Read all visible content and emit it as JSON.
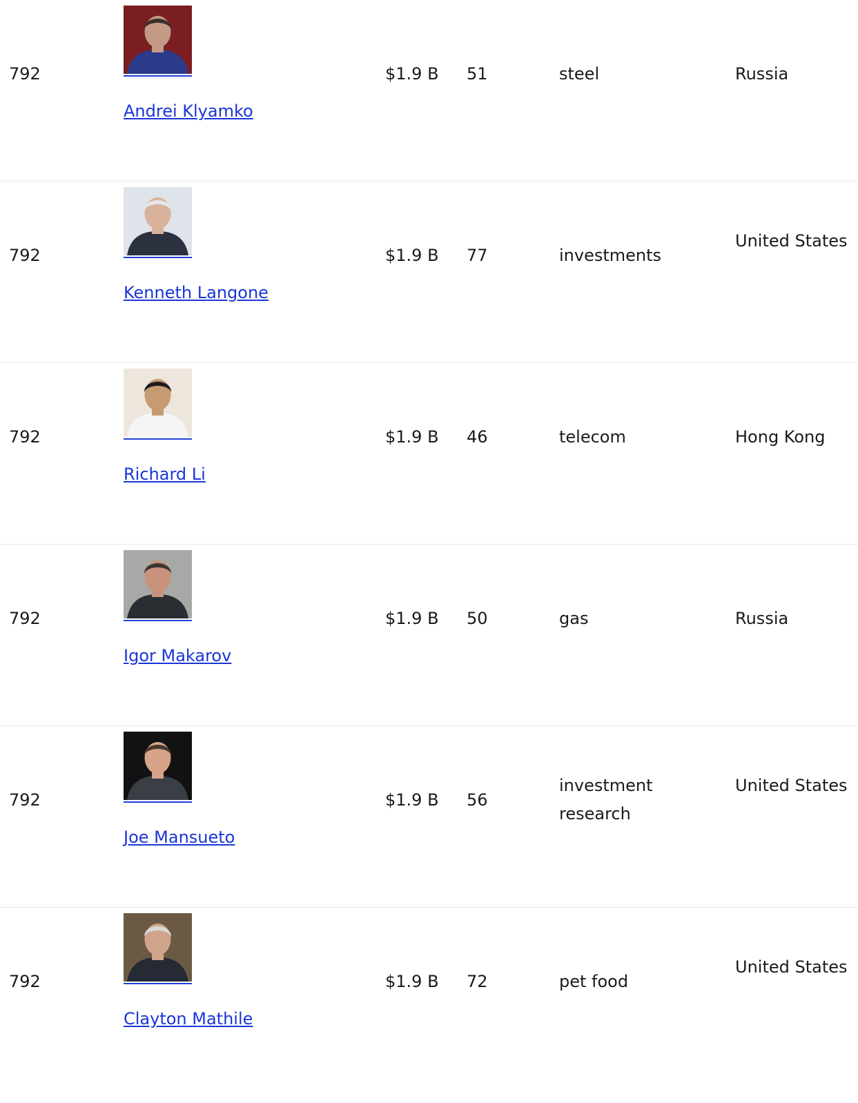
{
  "rows": [
    {
      "rank": "792",
      "name": "Andrei Klyamko",
      "net_worth": "$1.9 B",
      "age": "51",
      "source": "steel",
      "country": "Russia",
      "photo": {
        "bg": "#7a1e22",
        "skin": "#c49a86",
        "shirt": "#2b3a8a",
        "hair": "#3a2f2a"
      }
    },
    {
      "rank": "792",
      "name": "Kenneth Langone",
      "net_worth": "$1.9 B",
      "age": "77",
      "source": "investments",
      "country": "United States",
      "photo": {
        "bg": "#dfe3ea",
        "skin": "#d9b29b",
        "shirt": "#2c3140",
        "hair": "#e6e6e6"
      }
    },
    {
      "rank": "792",
      "name": "Richard Li",
      "net_worth": "$1.9 B",
      "age": "46",
      "source": "telecom",
      "country": "Hong Kong",
      "photo": {
        "bg": "#ece6dc",
        "skin": "#c79b72",
        "shirt": "#f5f5f5",
        "hair": "#1c1c1c"
      }
    },
    {
      "rank": "792",
      "name": "Igor Makarov",
      "net_worth": "$1.9 B",
      "age": "50",
      "source": "gas",
      "country": "Russia",
      "photo": {
        "bg": "#a7a9a6",
        "skin": "#c8927c",
        "shirt": "#2a2e33",
        "hair": "#3b3531"
      }
    },
    {
      "rank": "792",
      "name": "Joe Mansueto",
      "net_worth": "$1.9 B",
      "age": "56",
      "source": "investment research",
      "country": "United States",
      "photo": {
        "bg": "#121212",
        "skin": "#d7a48a",
        "shirt": "#3a3f46",
        "hair": "#4a3a30"
      }
    },
    {
      "rank": "792",
      "name": "Clayton Mathile",
      "net_worth": "$1.9 B",
      "age": "72",
      "source": "pet food",
      "country": "United States",
      "photo": {
        "bg": "#6a5a44",
        "skin": "#d1a58c",
        "shirt": "#252a35",
        "hair": "#d8d8d8"
      }
    }
  ]
}
